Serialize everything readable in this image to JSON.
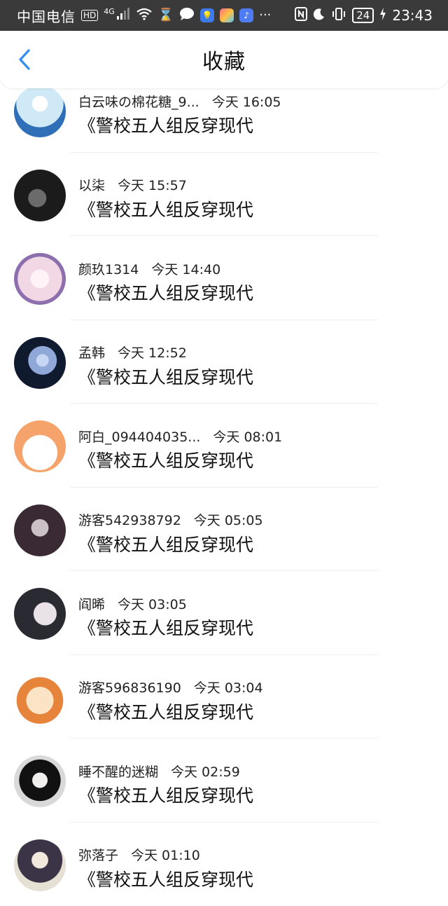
{
  "status_bar": {
    "carrier": "中国电信",
    "hd": "HD",
    "network": "4G",
    "battery": "24",
    "time": "23:43"
  },
  "header": {
    "title": "收藏"
  },
  "items": [
    {
      "name": "白云味の棉花糖_9...",
      "date": "今天 16:05",
      "book": "《警校五人组反穿现代",
      "avatar_colors": [
        "#cfe9f6",
        "#2f6fb8"
      ]
    },
    {
      "name": "以柒",
      "date": "今天 15:57",
      "book": "《警校五人组反穿现代",
      "avatar_colors": [
        "#1b1b1b",
        "#6b6b6b"
      ]
    },
    {
      "name": "颜玖1314",
      "date": "今天 14:40",
      "book": "《警校五人组反穿现代",
      "avatar_colors": [
        "#f2d7e4",
        "#8d6fae"
      ]
    },
    {
      "name": "孟韩",
      "date": "今天 12:52",
      "book": "《警校五人组反穿现代",
      "avatar_colors": [
        "#0f1a2e",
        "#8fa8d8"
      ]
    },
    {
      "name": "阿白_094404035...",
      "date": "今天 08:01",
      "book": "《警校五人组反穿现代",
      "avatar_colors": [
        "#f5a36a",
        "#ffffff"
      ]
    },
    {
      "name": "游客542938792",
      "date": "今天 05:05",
      "book": "《警校五人组反穿现代",
      "avatar_colors": [
        "#3a2a33",
        "#c9c1c6"
      ]
    },
    {
      "name": "阎晞",
      "date": "今天 03:05",
      "book": "《警校五人组反穿现代",
      "avatar_colors": [
        "#2a2a33",
        "#e9e3e8"
      ]
    },
    {
      "name": "游客596836190",
      "date": "今天 03:04",
      "book": "《警校五人组反穿现代",
      "avatar_colors": [
        "#fbe4c6",
        "#e7843c"
      ]
    },
    {
      "name": "睡不醒的迷糊",
      "date": "今天 02:59",
      "book": "《警校五人组反穿现代",
      "avatar_colors": [
        "#d9d9d9",
        "#111111"
      ]
    },
    {
      "name": "弥落子",
      "date": "今天 01:10",
      "book": "《警校五人组反穿现代",
      "avatar_colors": [
        "#e6dfd3",
        "#3b3346"
      ]
    }
  ],
  "colors": {
    "accent": "#2f8ef0",
    "status_bar_bg": "#3a3a3a"
  },
  "icons": {
    "back": "chevron-left-icon"
  }
}
